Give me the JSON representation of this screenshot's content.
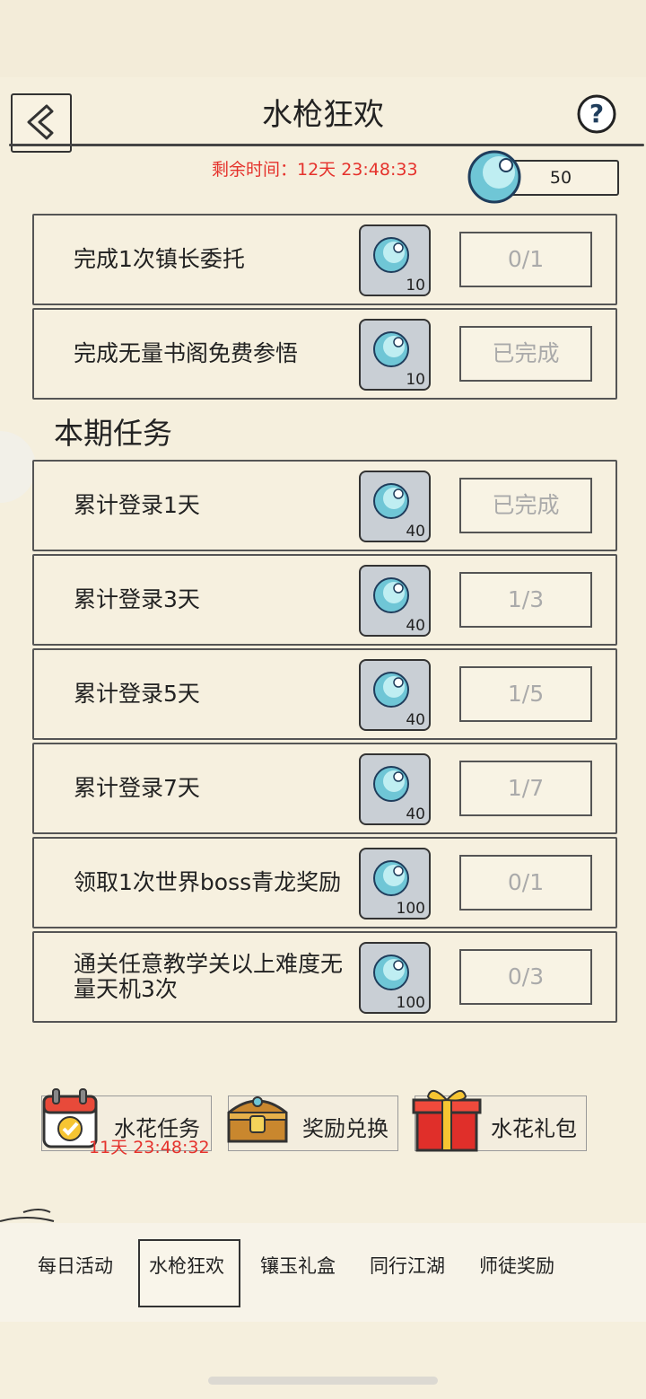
{
  "header": {
    "title": "水枪狂欢",
    "timer": "剩余时间：12天 23:48:33",
    "currency_count": "50"
  },
  "colors": {
    "accent_red": "#e5322c",
    "background": "#f5efdd"
  },
  "section_title": "本期任务",
  "tasks_top": [
    {
      "label": "完成1次镇长委托",
      "reward": "10",
      "status": "0/1"
    },
    {
      "label": "完成无量书阁免费参悟",
      "reward": "10",
      "status": "已完成"
    }
  ],
  "tasks_period": [
    {
      "label": "累计登录1天",
      "reward": "40",
      "status": "已完成"
    },
    {
      "label": "累计登录3天",
      "reward": "40",
      "status": "1/3"
    },
    {
      "label": "累计登录5天",
      "reward": "40",
      "status": "1/5"
    },
    {
      "label": "累计登录7天",
      "reward": "40",
      "status": "1/7"
    },
    {
      "label": "领取1次世界boss青龙奖励",
      "reward": "100",
      "status": "0/1"
    },
    {
      "label": "通关任意教学关以上难度无量天机3次",
      "reward": "100",
      "status": "0/3"
    }
  ],
  "bottom_buttons": {
    "splash_task": {
      "label": "水花任务",
      "timer": "11天 23:48:32"
    },
    "reward_exchange": {
      "label": "奖励兑换"
    },
    "splash_gift": {
      "label": "水花礼包"
    }
  },
  "tabs": [
    "每日活动",
    "水枪狂欢",
    "镶玉礼盒",
    "同行江湖",
    "师徒奖励"
  ],
  "icons": [
    "back-icon",
    "help-icon",
    "water-orb-icon",
    "calendar-icon",
    "treasure-chest-icon",
    "gift-box-icon"
  ]
}
